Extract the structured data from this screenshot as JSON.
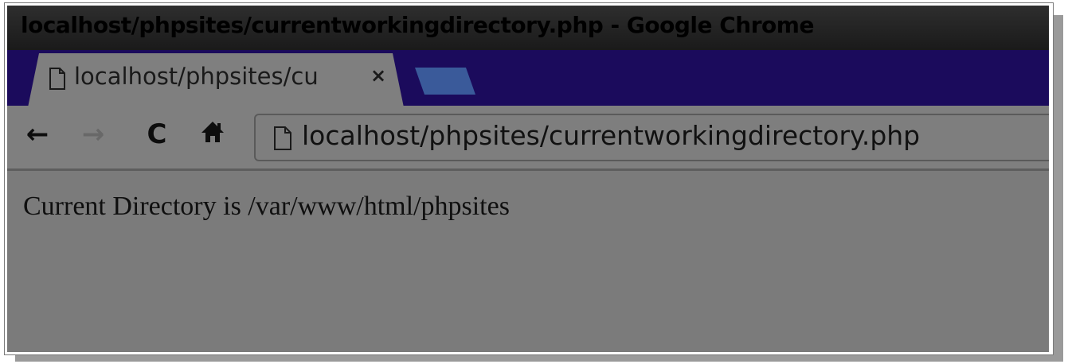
{
  "window": {
    "title": "localhost/phpsites/currentworkingdirectory.php - Google Chrome"
  },
  "tab": {
    "label": "localhost/phpsites/cu",
    "close_glyph": "×",
    "icon": "page-icon"
  },
  "toolbar": {
    "back_glyph": "←",
    "forward_glyph": "→",
    "reload_glyph": "C",
    "home_glyph": "🏠",
    "url": "localhost/phpsites/currentworkingdirectory.php"
  },
  "content": {
    "text": "Current Directory is /var/www/html/phpsites"
  },
  "colors": {
    "tabstrip": "#1b0b5c",
    "new_tab": "#3a5a9a",
    "chrome": "#7f7f7f"
  }
}
